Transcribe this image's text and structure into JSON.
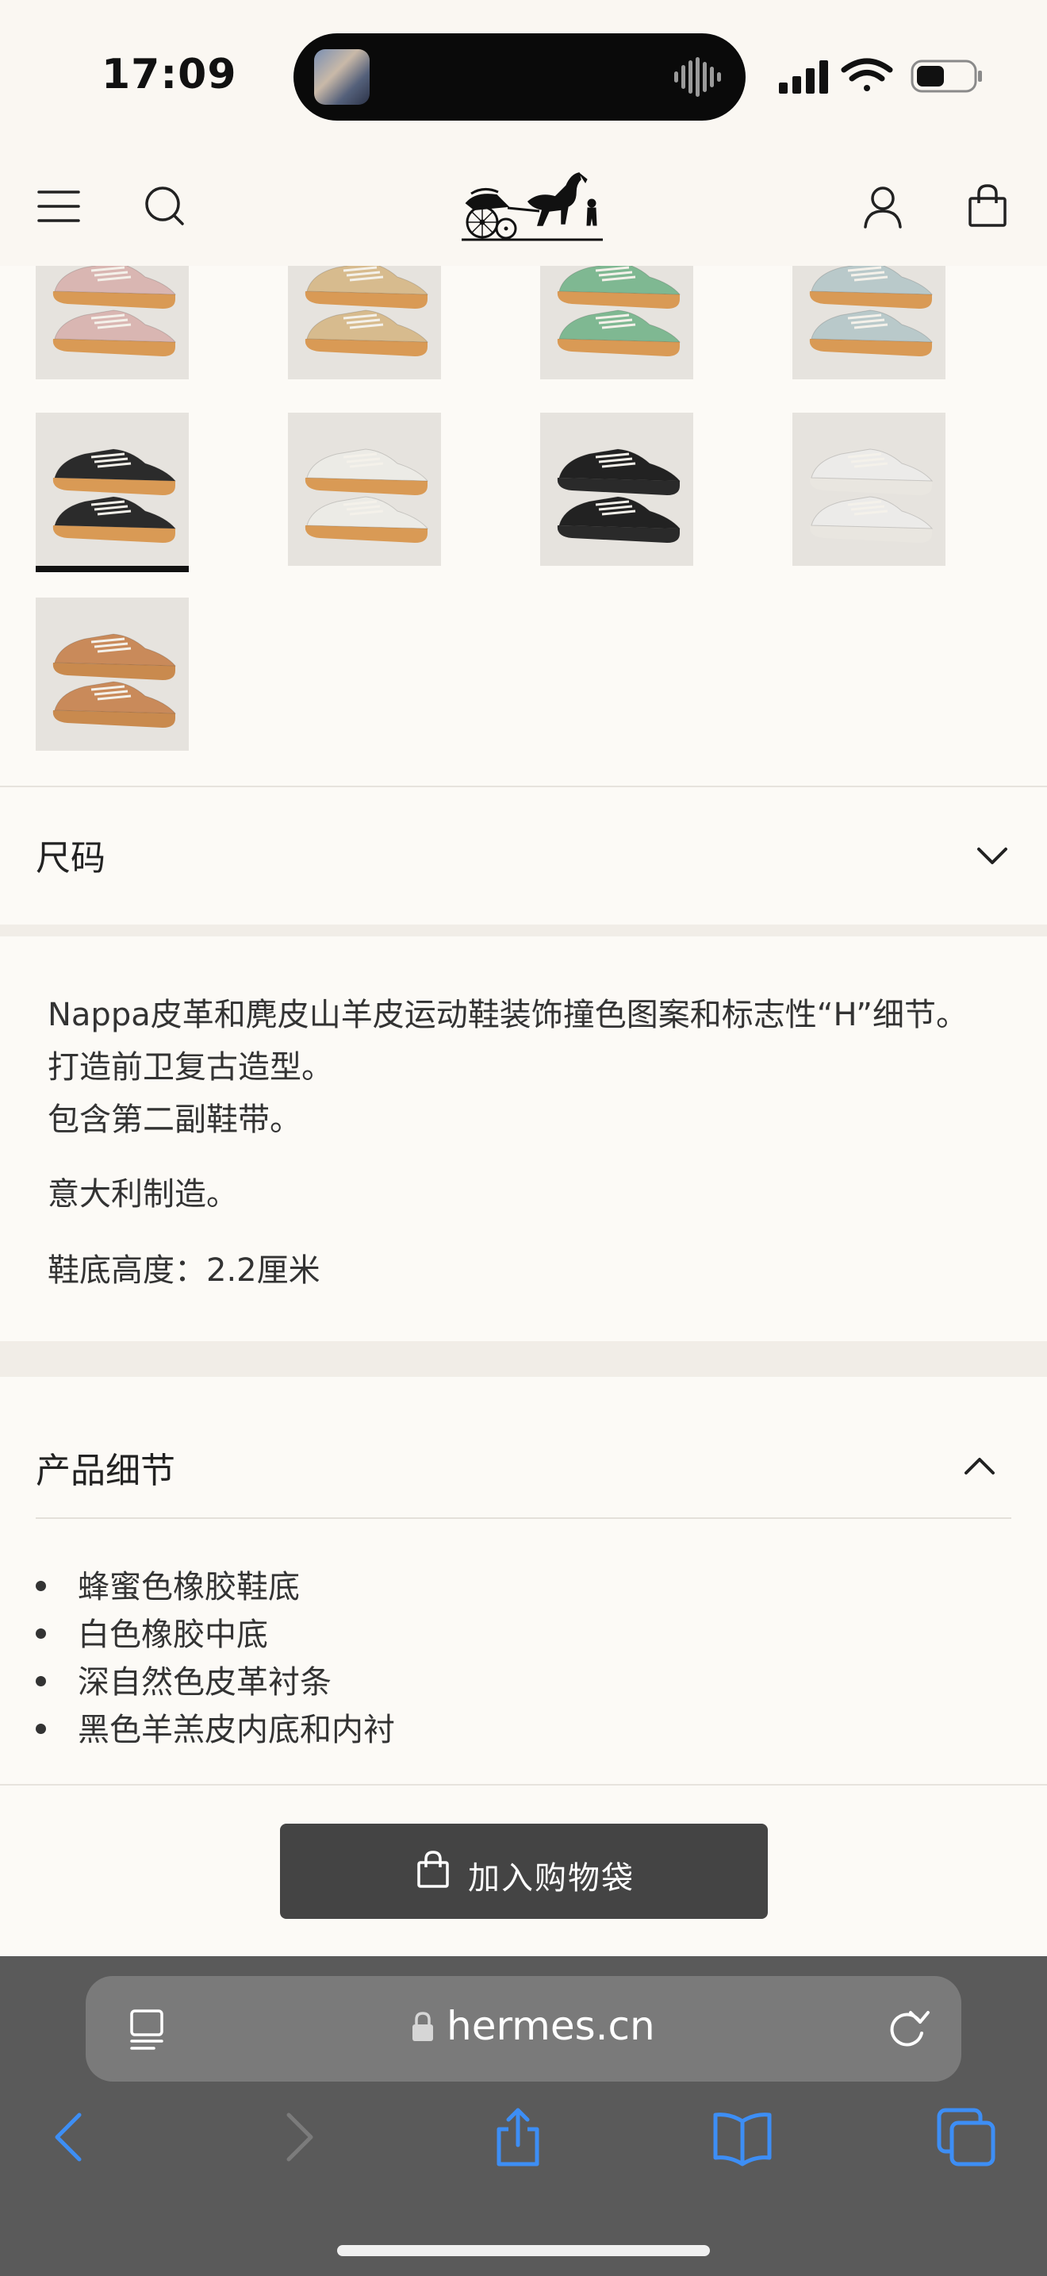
{
  "status_bar": {
    "time": "17:09"
  },
  "header": {
    "logo": "hermes-carriage-logo",
    "icons": [
      "menu-icon",
      "search-icon",
      "account-icon",
      "shopping-bag-icon"
    ]
  },
  "color_thumbnails": {
    "selected_index": 4,
    "items": [
      {
        "color": "pink",
        "upper": "#d9b6b2",
        "sole": "#d99a55"
      },
      {
        "color": "beige",
        "upper": "#d7bb8e",
        "sole": "#d99a55"
      },
      {
        "color": "green",
        "upper": "#7fb892",
        "sole": "#d99a55"
      },
      {
        "color": "light-blue",
        "upper": "#b9c9ca",
        "sole": "#d99a55"
      },
      {
        "color": "black",
        "upper": "#2b2b2b",
        "sole": "#d99a55"
      },
      {
        "color": "white",
        "upper": "#ecebe6",
        "sole": "#d99a55"
      },
      {
        "color": "black-black",
        "upper": "#222222",
        "sole": "#2a2a2a"
      },
      {
        "color": "all-white",
        "upper": "#ecebe9",
        "sole": "#e9e6e0"
      },
      {
        "color": "tan",
        "upper": "#c98a5a",
        "sole": "#c98a4e"
      }
    ]
  },
  "size_section": {
    "label": "尺码"
  },
  "description": {
    "line1": "Nappa皮革和麂皮山羊皮运动鞋装饰撞色图案和标志性“H”细节。",
    "line2": "打造前卫复古造型。",
    "line3": "包含第二副鞋带。",
    "line4": "意大利制造。",
    "line5": "鞋底高度：2.2厘米"
  },
  "details_section": {
    "title": "产品细节",
    "items": [
      "蜂蜜色橡胶鞋底",
      "白色橡胶中底",
      "深自然色皮革衬条",
      "黑色羊羔皮内底和内衬"
    ]
  },
  "add_to_bag": {
    "label": "加入购物袋"
  },
  "browser": {
    "url": "hermes.cn",
    "icons": [
      "reader-icon",
      "lock-icon",
      "reload-icon",
      "back-icon",
      "forward-icon",
      "share-icon",
      "bookmarks-icon",
      "tabs-icon"
    ]
  },
  "colors": {
    "page_bg": "#fcfaf6",
    "button_bg": "#444444",
    "browser_bar": "#5a5a5a",
    "link_blue": "#3d8ef5"
  }
}
